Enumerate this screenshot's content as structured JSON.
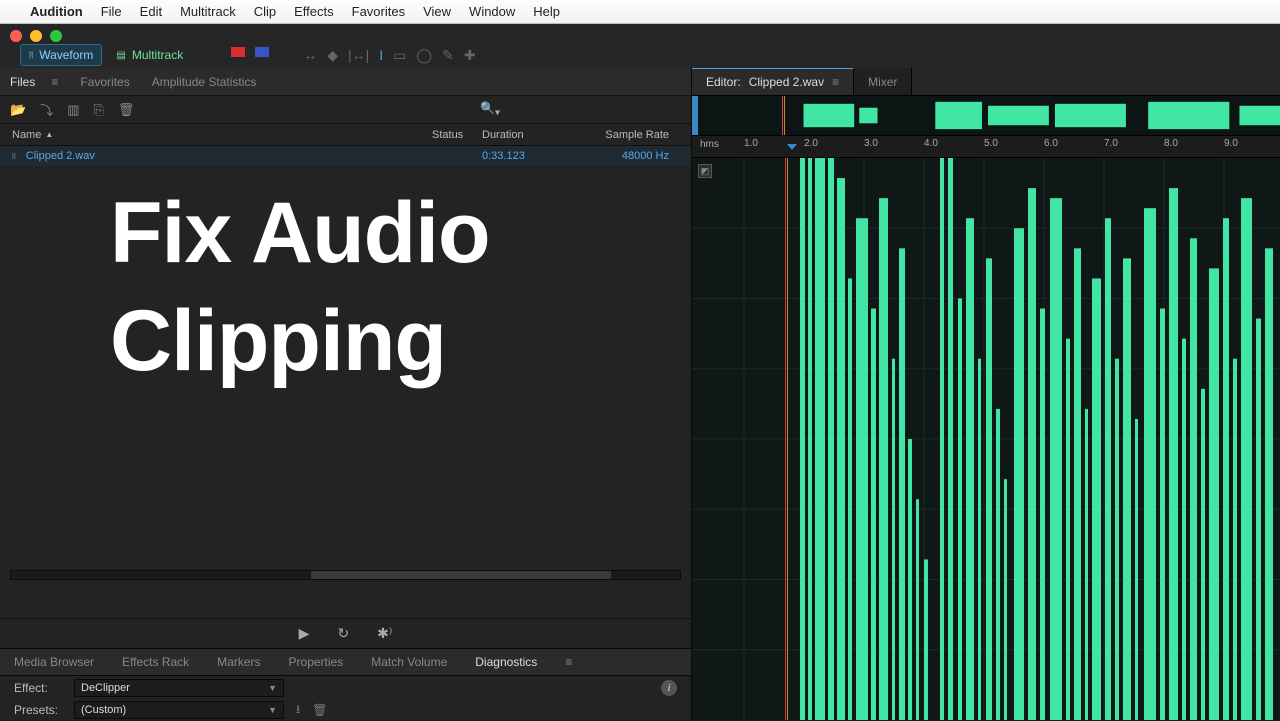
{
  "menubar": {
    "app": "Audition",
    "items": [
      "File",
      "Edit",
      "Multitrack",
      "Clip",
      "Effects",
      "Favorites",
      "View",
      "Window",
      "Help"
    ]
  },
  "viewmodes": {
    "waveform": "Waveform",
    "multitrack": "Multitrack"
  },
  "left_panel_tabs": {
    "files": "Files",
    "favorites": "Favorites",
    "ampstats": "Amplitude Statistics"
  },
  "file_table": {
    "headers": {
      "name": "Name",
      "status": "Status",
      "duration": "Duration",
      "sample_rate": "Sample Rate"
    },
    "rows": [
      {
        "name": "Clipped 2.wav",
        "status": "",
        "duration": "0:33.123",
        "sample_rate": "48000 Hz"
      }
    ]
  },
  "search_placeholder": "",
  "overlay_text": {
    "line1": "Fix Audio",
    "line2": "Clipping"
  },
  "bottom_tabs": [
    "Media Browser",
    "Effects Rack",
    "Markers",
    "Properties",
    "Match Volume",
    "Diagnostics"
  ],
  "diagnostics": {
    "effect_label": "Effect:",
    "effect_value": "DeClipper",
    "presets_label": "Presets:",
    "presets_value": "(Custom)"
  },
  "editor_tabs": {
    "editor_prefix": "Editor:",
    "file": "Clipped 2.wav",
    "mixer": "Mixer"
  },
  "ruler": {
    "unit": "hms",
    "ticks": [
      "1.0",
      "2.0",
      "3.0",
      "4.0",
      "5.0",
      "6.0",
      "7.0",
      "8.0",
      "9.0"
    ]
  },
  "colors": {
    "waveform": "#42e6a4",
    "playhead": "#d03838",
    "accent": "#4aa0e0"
  }
}
